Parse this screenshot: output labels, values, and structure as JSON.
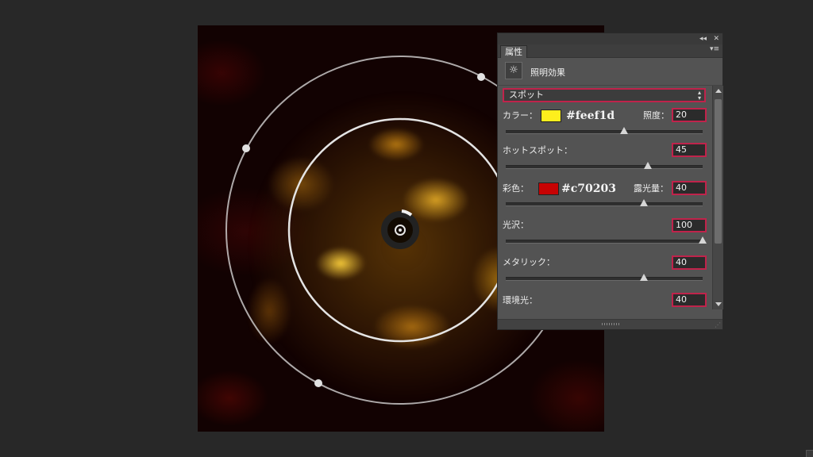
{
  "panel": {
    "collapse_glyph": "◂◂",
    "close_glyph": "✕",
    "tab_label": "属性",
    "menu_glyph": "▾≡",
    "effect_icon": "light-effect-icon",
    "effect_icon_glyph": "☼",
    "effect_title": "照明効果",
    "preset": {
      "value": "スポット",
      "arrows": "▴▾"
    },
    "color": {
      "label": "カラー：",
      "swatch": "#feef1d",
      "hex": "#feef1d",
      "intensity_label": "照度：",
      "intensity_value": "20",
      "intensity_level": 0.6
    },
    "hotspot": {
      "label": "ホットスポット：",
      "value": "45",
      "level": 0.72
    },
    "colorize": {
      "label": "彩色：",
      "swatch": "#c70203",
      "hex": "#c70203",
      "exposure_label": "露光量：",
      "exposure_value": "40",
      "exposure_level": 0.7
    },
    "gloss": {
      "label": "光沢：",
      "value": "100",
      "level": 1.0
    },
    "metallic": {
      "label": "メタリック：",
      "value": "40",
      "level": 0.7
    },
    "ambience": {
      "label": "環境光：",
      "value": "40"
    }
  },
  "colors": {
    "accent_border": "#c0234b",
    "panel_bg": "#535353",
    "app_bg": "#282828"
  }
}
